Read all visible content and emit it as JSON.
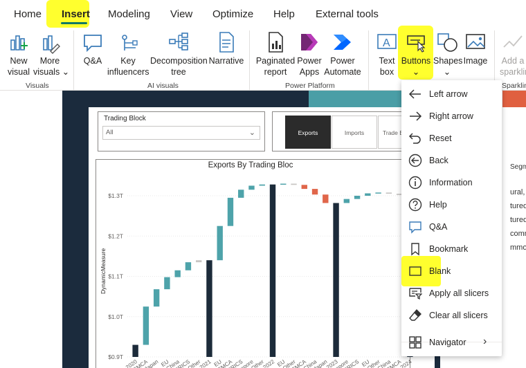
{
  "tabs": [
    {
      "label": "Home"
    },
    {
      "label": "Insert"
    },
    {
      "label": "Modeling"
    },
    {
      "label": "View"
    },
    {
      "label": "Optimize"
    },
    {
      "label": "Help"
    },
    {
      "label": "External tools"
    }
  ],
  "ribbon": {
    "buttons": {
      "new_visual": [
        "New",
        "visual"
      ],
      "more_visuals": [
        "More",
        "visuals ⌄"
      ],
      "qa": [
        "Q&A"
      ],
      "key_influencers": [
        "Key",
        "influencers"
      ],
      "decomposition_tree": [
        "Decomposition",
        "tree"
      ],
      "narrative": [
        "Narrative"
      ],
      "paginated_report": [
        "Paginated",
        "report"
      ],
      "power_apps": [
        "Power",
        "Apps"
      ],
      "power_automate": [
        "Power",
        "Automate"
      ],
      "text_box": [
        "Text",
        "box"
      ],
      "buttons": [
        "Buttons",
        "⌄"
      ],
      "shapes": [
        "Shapes",
        "⌄"
      ],
      "image": [
        "Image"
      ],
      "add_sparkline": [
        "Add a",
        "sparklin"
      ]
    },
    "groups": {
      "visuals": "Visuals",
      "ai_visuals": "AI visuals",
      "power_platform": "Power Platform",
      "sparklines": "Sparklin"
    }
  },
  "report": {
    "slicer": {
      "title": "Trading Block",
      "value": "All"
    },
    "segments": [
      {
        "label": "Exports",
        "active": true
      },
      {
        "label": "Imports",
        "active": false
      },
      {
        "label": "Trade B",
        "active": false
      }
    ],
    "right_text": [
      "Segmen",
      "ural, for",
      "tured c",
      "tured c",
      "commo",
      "mmodi"
    ]
  },
  "chart_data": {
    "type": "waterfall",
    "title": "Exports By Trading Bloc",
    "ylabel": "DynamicMeasure",
    "ylim": [
      0.9,
      1.33
    ],
    "y_ticks": [
      "$0.9T",
      "$1.0T",
      "$1.1T",
      "$1.2T",
      "$1.3T"
    ],
    "y_tick_values": [
      0.9,
      1.0,
      1.1,
      1.2,
      1.3
    ],
    "colors": {
      "total": "#1c2b3a",
      "increase": "#4ea3aa",
      "decrease": "#e0664a",
      "neutral": "#c8c6c4"
    },
    "categories": [
      "2020",
      "ACMCA",
      "Japan",
      "EU",
      "China",
      "BRICS",
      "Other",
      "2021",
      "EU",
      "ACMCA",
      "BRICS",
      "Singapore",
      "Other",
      "2022",
      "EU",
      "Other",
      "ACMCA",
      "China",
      "Japan",
      "2023",
      "Singapore",
      "BRICS",
      "EU",
      "Other",
      "China",
      "ACMCA",
      "2024"
    ],
    "bars": [
      {
        "start": 0.9,
        "end": 0.93,
        "kind": "total"
      },
      {
        "start": 0.93,
        "end": 1.025,
        "kind": "increase"
      },
      {
        "start": 1.025,
        "end": 1.068,
        "kind": "increase"
      },
      {
        "start": 1.068,
        "end": 1.098,
        "kind": "increase"
      },
      {
        "start": 1.098,
        "end": 1.115,
        "kind": "increase"
      },
      {
        "start": 1.115,
        "end": 1.135,
        "kind": "increase"
      },
      {
        "start": 1.135,
        "end": 1.14,
        "kind": "neutral"
      },
      {
        "start": 0.9,
        "end": 1.14,
        "kind": "total"
      },
      {
        "start": 1.14,
        "end": 1.225,
        "kind": "increase"
      },
      {
        "start": 1.225,
        "end": 1.295,
        "kind": "increase"
      },
      {
        "start": 1.295,
        "end": 1.315,
        "kind": "increase"
      },
      {
        "start": 1.315,
        "end": 1.325,
        "kind": "increase"
      },
      {
        "start": 1.325,
        "end": 1.328,
        "kind": "increase"
      },
      {
        "start": 0.9,
        "end": 1.328,
        "kind": "total"
      },
      {
        "start": 1.328,
        "end": 1.33,
        "kind": "increase"
      },
      {
        "start": 1.33,
        "end": 1.327,
        "kind": "neutral"
      },
      {
        "start": 1.327,
        "end": 1.317,
        "kind": "decrease"
      },
      {
        "start": 1.317,
        "end": 1.303,
        "kind": "decrease"
      },
      {
        "start": 1.303,
        "end": 1.282,
        "kind": "decrease"
      },
      {
        "start": 0.9,
        "end": 1.282,
        "kind": "total"
      },
      {
        "start": 1.282,
        "end": 1.292,
        "kind": "increase"
      },
      {
        "start": 1.292,
        "end": 1.3,
        "kind": "increase"
      },
      {
        "start": 1.3,
        "end": 1.306,
        "kind": "increase"
      },
      {
        "start": 1.306,
        "end": 1.308,
        "kind": "increase"
      },
      {
        "start": 1.308,
        "end": 1.305,
        "kind": "neutral"
      },
      {
        "start": 1.305,
        "end": 1.302,
        "kind": "neutral"
      },
      {
        "start": 0.9,
        "end": 1.3,
        "kind": "total"
      }
    ]
  },
  "menu": {
    "items": [
      {
        "label": "Left arrow",
        "icon": "left-arrow-icon"
      },
      {
        "label": "Right arrow",
        "icon": "right-arrow-icon"
      },
      {
        "label": "Reset",
        "icon": "reset-icon"
      },
      {
        "label": "Back",
        "icon": "back-icon"
      },
      {
        "label": "Information",
        "icon": "information-icon"
      },
      {
        "label": "Help",
        "icon": "help-icon"
      },
      {
        "label": "Q&A",
        "icon": "qa-icon"
      },
      {
        "label": "Bookmark",
        "icon": "bookmark-icon"
      },
      {
        "label": "Blank",
        "icon": "blank-icon"
      },
      {
        "label": "Apply all slicers",
        "icon": "apply-slicers-icon"
      },
      {
        "label": "Clear all slicers",
        "icon": "clear-slicers-icon"
      },
      {
        "label": "Navigator",
        "icon": "navigator-icon"
      }
    ]
  },
  "highlight_color": "#ffff2e",
  "accent_color": "#117865"
}
